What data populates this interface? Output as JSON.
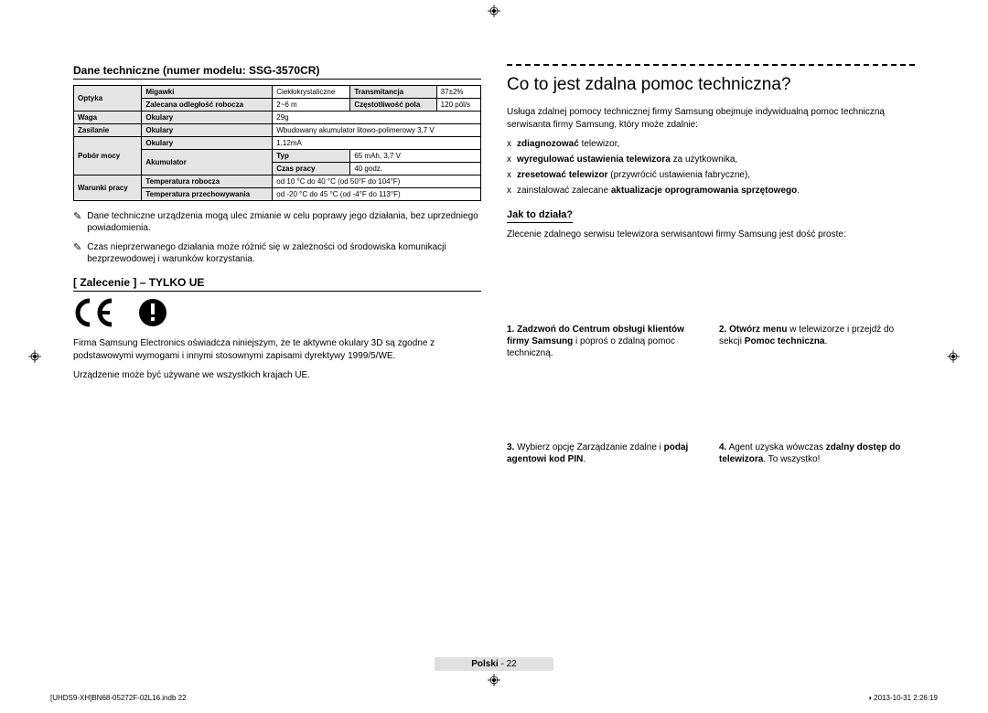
{
  "left": {
    "spec_heading": "Dane techniczne (numer modelu: SSG-3570CR)",
    "table": {
      "r1": {
        "c1": "Optyka",
        "c2": "Migawki",
        "c3": "Ciekłokrystaliczne",
        "c4": "Transmitancja",
        "c5": "37±2%"
      },
      "r2": {
        "c2": "Zalecana odległość robocza",
        "c3": "2~6 m",
        "c4": "Częstotliwość pola",
        "c5": "120 pól/s"
      },
      "r3": {
        "c1": "Waga",
        "c2": "Okulary",
        "c3": "29g"
      },
      "r4": {
        "c1": "Zasilanie",
        "c2": "Okulary",
        "c3": "Wbudowany akumulator litowo-polimerowy 3,7 V"
      },
      "r5": {
        "c1": "Pobór mocy",
        "c2": "Okulary",
        "c3": "1,12mA"
      },
      "r6": {
        "c2": "Akumulator",
        "c3": "Typ",
        "c4": "65 mAh, 3,7 V"
      },
      "r7": {
        "c3": "Czas pracy",
        "c4": "40 godz."
      },
      "r8": {
        "c1": "Warunki pracy",
        "c2": "Temperatura robocza",
        "c3": "od 10 °C do 40 °C (od 50°F do 104°F)"
      },
      "r9": {
        "c2": "Temperatura przechowywania",
        "c3": "od -20 °C do 45 °C (od -4°F do 113°F)"
      }
    },
    "note1": "Dane techniczne urządzenia mogą ulec zmianie w celu poprawy jego działania, bez uprzedniego powiadomienia.",
    "note2": "Czas nieprzerwanego działania może różnić się w zależności od środowiska komunikacji bezprzewodowej i warunków korzystania.",
    "rec_heading": "[ Zalecenie ] – TYLKO UE",
    "ce_para": "Firma Samsung Electronics oświadcza niniejszym, że te aktywne okulary 3D są zgodne z podstawowymi wymogami i innymi stosownymi zapisami dyrektywy 1999/5/WE.",
    "ce_para2": "Urządzenie może być używane we wszystkich krajach UE."
  },
  "right": {
    "title": "Co to jest zdalna pomoc techniczna?",
    "intro": "Usługa zdalnej pomocy technicznej firmy Samsung obejmuje indywidualną pomoc techniczną serwisanta firmy Samsung, który może zdalnie:",
    "b1_pre": "zdiagnozować",
    "b1_post": " telewizor,",
    "b2_pre": "wyregulować ustawienia telewizora",
    "b2_post": " za użytkownika,",
    "b3_pre": "zresetować telewizor",
    "b3_post": " (przywrócić ustawienia fabryczne),",
    "b4_pre": "zainstalować zalecane ",
    "b4_bold": "aktualizacje oprogramowania sprzętowego",
    "b4_post": ".",
    "how_heading": "Jak to działa?",
    "how_intro": "Zlecenie zdalnego serwisu telewizora serwisantowi firmy Samsung jest dość proste:",
    "step1_num": "1.",
    "step1_bold": "Zadzwoń do Centrum obsługi klientów firmy Samsung",
    "step1_rest": " i poproś o zdalną pomoc techniczną.",
    "step2_num": "2.",
    "step2_bold": "Otwórz menu",
    "step2_rest": " w telewizorze i przejdź do sekcji ",
    "step2_bold2": "Pomoc techniczna",
    "step2_rest2": ".",
    "step3_num": "3.",
    "step3_rest": "Wybierz opcję Zarządzanie zdalne i ",
    "step3_bold": "podaj agentowi kod PIN",
    "step3_rest2": ".",
    "step4_num": "4.",
    "step4_rest": "Agent uzyska wówczas ",
    "step4_bold": "zdalny dostęp do telewizora",
    "step4_rest2": ". To wszystko!"
  },
  "footer": {
    "lang": "Polski",
    "page": "22",
    "indd": "[UHDS9-XH]BN68-05272F-02L16.indb   22",
    "timestamp": "2013-10-31    2:26:19"
  }
}
